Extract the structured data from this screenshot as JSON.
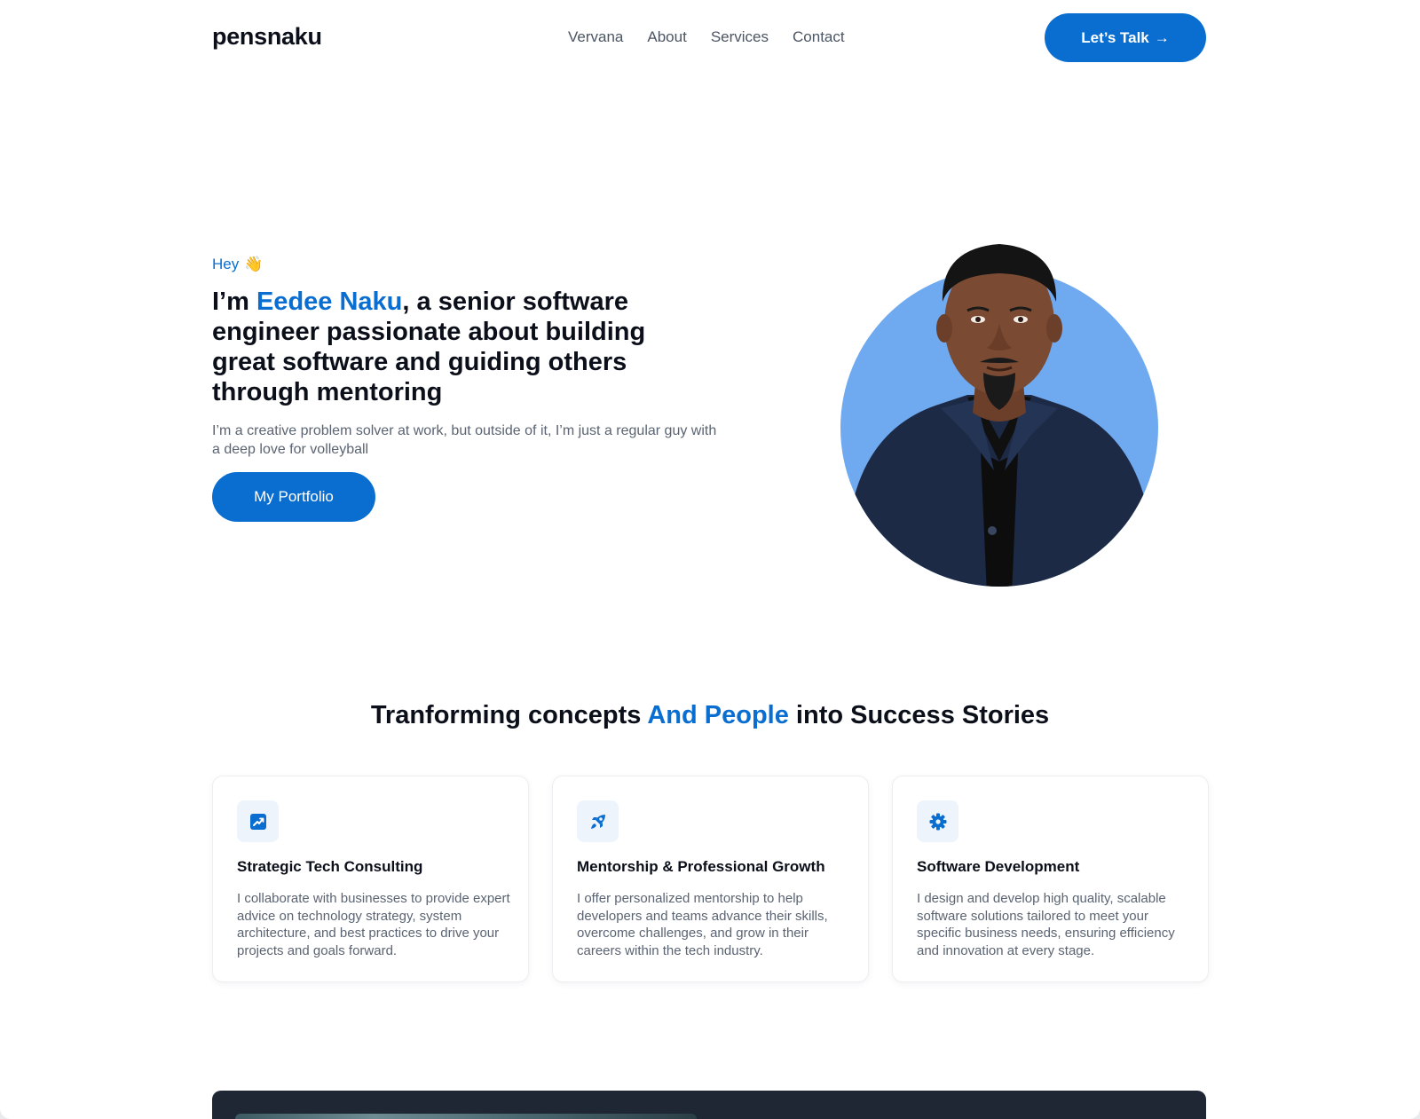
{
  "header": {
    "logo": "pensnaku",
    "nav": [
      "Vervana",
      "About",
      "Services",
      "Contact"
    ],
    "cta_label": "Let’s Talk",
    "cta_arrow": "→"
  },
  "hero": {
    "greeting": "Hey",
    "greeting_emoji": "👋",
    "title_prefix": "I’m ",
    "title_name": "Eedee Naku",
    "title_suffix": ", a senior software engineer passionate about building great software and guiding others through mentoring",
    "subtitle": "I’m a creative problem solver at work, but outside of it, I’m just a regular guy with a deep love for volleyball",
    "button_label": "My Portfolio"
  },
  "services": {
    "title_part1": "Tranforming concepts ",
    "title_accent": "And People",
    "title_part2": " into Success Stories",
    "cards": [
      {
        "icon": "trending-chart-icon",
        "title": "Strategic Tech Consulting",
        "text": "I collaborate with businesses to provide expert advice on technology strategy, system architecture, and best practices to drive your projects and goals forward."
      },
      {
        "icon": "rocket-icon",
        "title": "Mentorship & Professional Growth",
        "text": "I offer personalized mentorship to help developers and teams advance their skills, overcome challenges, and grow in their careers within the tech industry."
      },
      {
        "icon": "gear-icon",
        "title": "Software Development",
        "text": "I design and develop high quality, scalable software solutions tailored to meet your specific business needs, ensuring efficiency and innovation at every stage."
      }
    ]
  },
  "colors": {
    "accent": "#0a6ed1",
    "avatar_bg": "#6fa9f0",
    "dark_section": "#1e2733"
  }
}
